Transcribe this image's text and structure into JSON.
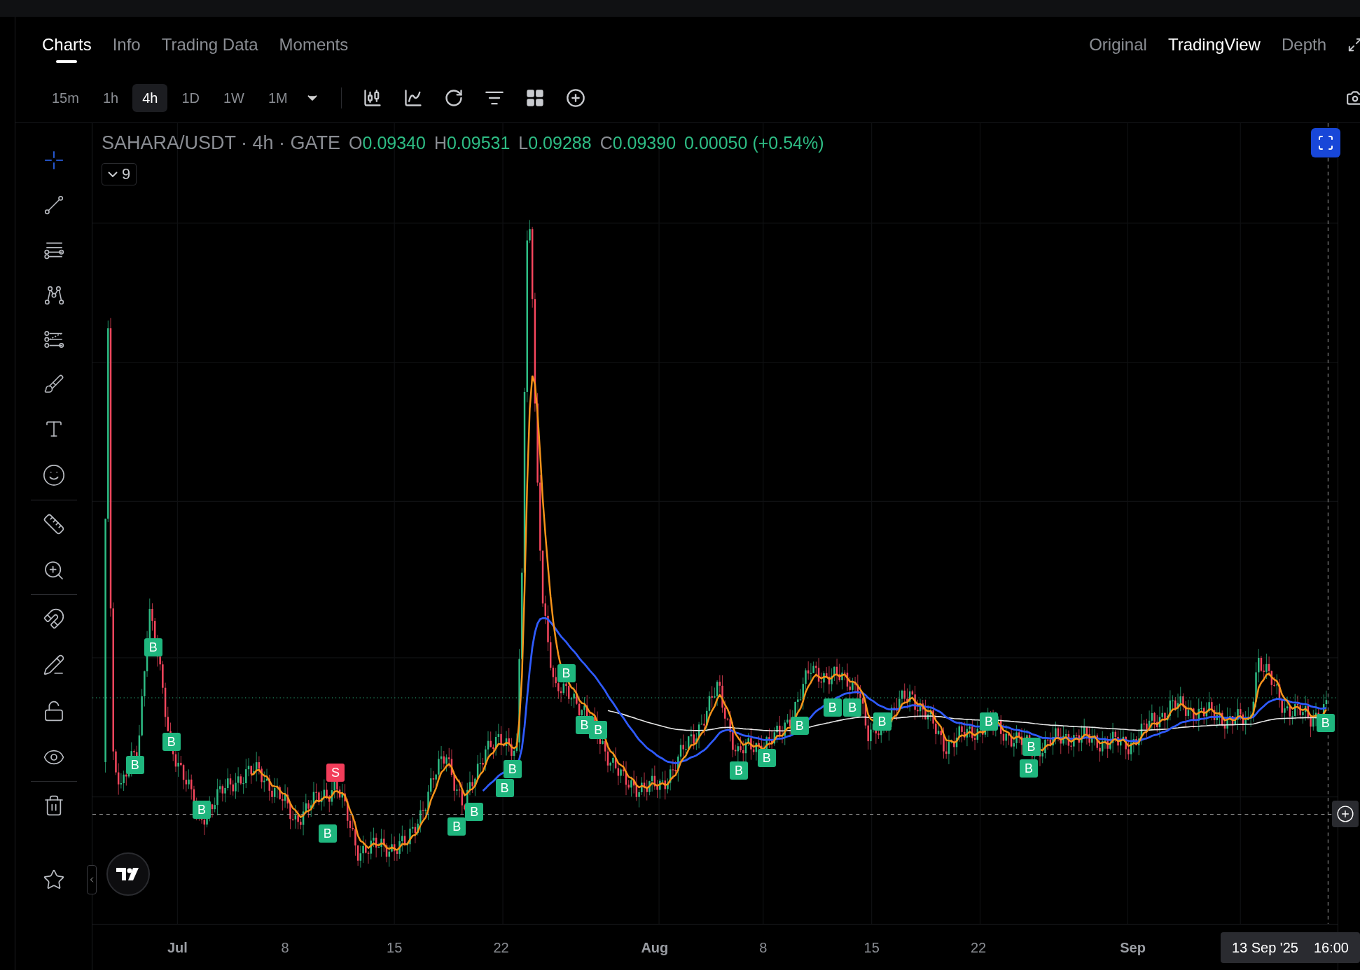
{
  "tabs": [
    {
      "label": "Charts",
      "selected": true
    },
    {
      "label": "Info",
      "selected": false
    },
    {
      "label": "Trading Data",
      "selected": false
    },
    {
      "label": "Moments",
      "selected": false
    }
  ],
  "view_modes": [
    {
      "label": "Original",
      "selected": false
    },
    {
      "label": "TradingView",
      "selected": true
    },
    {
      "label": "Depth",
      "selected": false
    }
  ],
  "intervals": [
    {
      "label": "15m",
      "selected": false
    },
    {
      "label": "1h",
      "selected": false
    },
    {
      "label": "4h",
      "selected": true
    },
    {
      "label": "1D",
      "selected": false
    },
    {
      "label": "1W",
      "selected": false
    },
    {
      "label": "1M",
      "selected": false
    }
  ],
  "drawing_tools": [
    [
      {
        "kind": "crosshair",
        "selected": true
      },
      {
        "kind": "trend-line",
        "selected": false
      },
      {
        "kind": "fib",
        "selected": false
      },
      {
        "kind": "pattern",
        "selected": false
      },
      {
        "kind": "forecast",
        "selected": false
      },
      {
        "kind": "brush",
        "selected": false
      },
      {
        "kind": "text",
        "selected": false
      },
      {
        "kind": "emoji",
        "selected": false
      }
    ],
    [
      {
        "kind": "ruler",
        "selected": false
      },
      {
        "kind": "zoom",
        "selected": false
      }
    ],
    [
      {
        "kind": "magnet",
        "selected": false
      },
      {
        "kind": "lock-drawing",
        "selected": false
      },
      {
        "kind": "lock",
        "selected": false
      },
      {
        "kind": "hide",
        "selected": false
      }
    ],
    [
      {
        "kind": "trash",
        "selected": false
      }
    ],
    [
      {
        "kind": "star",
        "selected": false
      }
    ]
  ],
  "chart": {
    "symbol": "SAHARA/USDT · 4h · GATE",
    "ohlc": [
      {
        "label": "O",
        "value": "0.09340"
      },
      {
        "label": "H",
        "value": "0.09531"
      },
      {
        "label": "L",
        "value": "0.09288"
      },
      {
        "label": "C",
        "value": "0.09390"
      }
    ],
    "change": "0.00050 (+0.54%)",
    "indicators_count": "9",
    "markers": [
      {
        "label": "B",
        "kind": "buy"
      },
      {
        "label": "B",
        "kind": "buy"
      },
      {
        "label": "B",
        "kind": "buy"
      },
      {
        "label": "B",
        "kind": "buy"
      },
      {
        "label": "B",
        "kind": "buy"
      },
      {
        "label": "S",
        "kind": "sell"
      },
      {
        "label": "B",
        "kind": "buy"
      },
      {
        "label": "B",
        "kind": "buy"
      },
      {
        "label": "B",
        "kind": "buy"
      },
      {
        "label": "B",
        "kind": "buy"
      },
      {
        "label": "B",
        "kind": "buy"
      },
      {
        "label": "B",
        "kind": "buy"
      },
      {
        "label": "B",
        "kind": "buy"
      },
      {
        "label": "B",
        "kind": "buy"
      },
      {
        "label": "B",
        "kind": "buy"
      },
      {
        "label": "B",
        "kind": "buy"
      },
      {
        "label": "B",
        "kind": "buy"
      },
      {
        "label": "B",
        "kind": "buy"
      },
      {
        "label": "B",
        "kind": "buy"
      },
      {
        "label": "B",
        "kind": "buy"
      },
      {
        "label": "B",
        "kind": "buy"
      },
      {
        "label": "B",
        "kind": "buy"
      },
      {
        "label": "B",
        "kind": "buy"
      }
    ],
    "x_axis": [
      {
        "label": "Jul",
        "kind": "month"
      },
      {
        "label": "8",
        "kind": "day"
      },
      {
        "label": "15",
        "kind": "day"
      },
      {
        "label": "22",
        "kind": "day"
      },
      {
        "label": "Aug",
        "kind": "month"
      },
      {
        "label": "8",
        "kind": "day"
      },
      {
        "label": "15",
        "kind": "day"
      },
      {
        "label": "22",
        "kind": "day"
      },
      {
        "label": "Sep",
        "kind": "month"
      }
    ],
    "crosshair_time": {
      "date": "13 Sep '25",
      "time": "16:00"
    }
  }
}
